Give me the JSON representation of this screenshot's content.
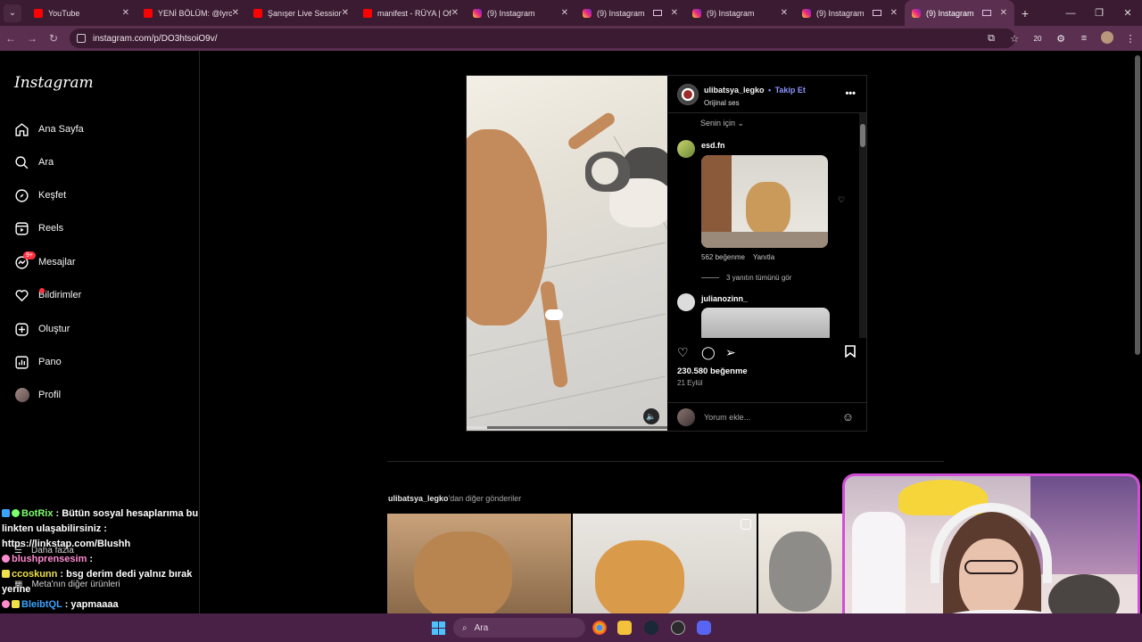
{
  "browser": {
    "tabs": [
      {
        "label": "YouTube",
        "icon": "youtube-favicon",
        "active": false
      },
      {
        "label": "YENİ BÖLÜM: @lyrox",
        "icon": "youtube-favicon",
        "active": false
      },
      {
        "label": "Şanışer Live Sessions",
        "icon": "youtube-favicon",
        "active": false
      },
      {
        "label": "manifest - RÜYA | Offi",
        "icon": "youtube-favicon",
        "active": false
      },
      {
        "label": "(9) Instagram",
        "icon": "instagram-favicon",
        "active": false
      },
      {
        "label": "(9) Instagram",
        "icon": "instagram-favicon",
        "active": false
      },
      {
        "label": "(9) Instagram",
        "icon": "instagram-favicon",
        "active": false
      },
      {
        "label": "(9) Instagram",
        "icon": "instagram-favicon",
        "active": false
      },
      {
        "label": "(9) Instagram",
        "icon": "instagram-favicon",
        "active": true
      }
    ],
    "url": "instagram.com/p/DO3htsoiO9v/",
    "extension_badge": "20"
  },
  "sidebar": {
    "logo": "Instagram",
    "items": [
      {
        "label": "Ana Sayfa",
        "icon": "home-icon"
      },
      {
        "label": "Ara",
        "icon": "search-icon"
      },
      {
        "label": "Keşfet",
        "icon": "compass-icon"
      },
      {
        "label": "Reels",
        "icon": "reels-icon"
      },
      {
        "label": "Mesajlar",
        "icon": "messenger-icon",
        "badge": "9+"
      },
      {
        "label": "Bildirimler",
        "icon": "heart-icon"
      },
      {
        "label": "Oluştur",
        "icon": "plus-square-icon"
      },
      {
        "label": "Pano",
        "icon": "dashboard-icon"
      },
      {
        "label": "Profil",
        "icon": "profile-avatar"
      }
    ],
    "more": "Daha fazla",
    "meta_more": "Meta'nın diğer ürünleri"
  },
  "post": {
    "username": "ulibatsya_legko",
    "follow": "Takip Et",
    "audio": "Orijinal ses",
    "for_you": "Senin için",
    "comments": [
      {
        "user": "esd.fn",
        "likes": "562 beğenme",
        "reply": "Yanıtla",
        "view_replies": "3 yanıtın tümünü gör"
      },
      {
        "user": "julianozinn_"
      }
    ],
    "likes": "230.580 beğenme",
    "date": "21 Eylül",
    "comment_placeholder": "Yorum ekle...",
    "video_progress": 0.1
  },
  "more_posts": {
    "user": "ulibatsya_legko",
    "suffix": "'dan diğer gönderiler"
  },
  "chat": [
    {
      "user": "BotRix",
      "text": ": Bütün sosyal hesaplarıma bu linkten ulaşabilirsiniz : https://linkstap.com/Blushh"
    },
    {
      "user": "blushprensesim",
      "text": ":"
    },
    {
      "user": "ccoskunn",
      "text": ": bsg derim dedi yalnız bırak yerine"
    },
    {
      "user": "BleibtQL",
      "text": ": yapmaaaa"
    }
  ],
  "taskbar": {
    "search": "Ara"
  },
  "colors": {
    "accent_follow": "#8b96ff",
    "notification_badge": "#ff3040",
    "browser_frame": "#3b1b31",
    "webcam_border": "#d04fd6"
  }
}
